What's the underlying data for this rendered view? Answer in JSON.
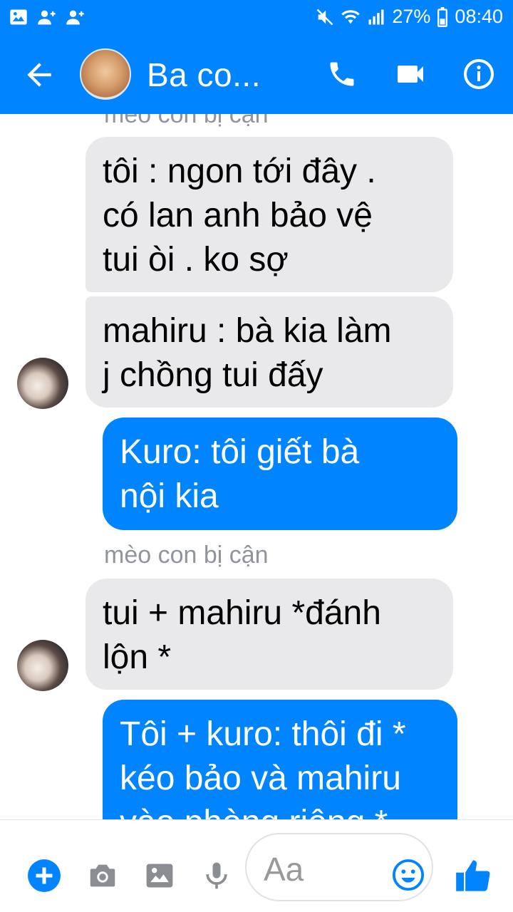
{
  "status_bar": {
    "battery": "27%",
    "time": "08:40",
    "icons": [
      "image-icon",
      "friend-request-icon",
      "friend-request-icon",
      "mute-icon",
      "wifi-icon",
      "signal-icon",
      "battery-icon"
    ]
  },
  "header": {
    "title": "Ba co...",
    "icons": [
      "back-arrow-icon",
      "phone-icon",
      "video-camera-icon",
      "info-icon"
    ]
  },
  "messages": [
    {
      "type": "label",
      "text": "mèo con bị cận"
    },
    {
      "type": "in",
      "text": "tôi : ngon tới đây .\ncó lan anh bảo vệ\ntui òi . ko sợ"
    },
    {
      "type": "in",
      "text": "mahiru : bà kia làm\nj chồng tui đấy"
    },
    {
      "type": "out",
      "text": "Kuro: tôi giết bà\nnội kia"
    },
    {
      "type": "label",
      "text": "mèo con bị cận"
    },
    {
      "type": "in",
      "text": "tui + mahiru *đánh\nlộn *"
    },
    {
      "type": "out",
      "text": "Tôi + kuro: thôi đi *\nkéo bảo và mahiru\nvào phòng riêng *"
    }
  ],
  "composer": {
    "placeholder": "Aa",
    "icons": [
      "plus-icon",
      "camera-icon",
      "image-icon",
      "mic-icon",
      "emoji-icon",
      "thumbs-up-icon"
    ]
  },
  "colors": {
    "accent": "#0084ff",
    "incoming_bubble": "#e9e9eb",
    "label_text": "#90949c"
  }
}
